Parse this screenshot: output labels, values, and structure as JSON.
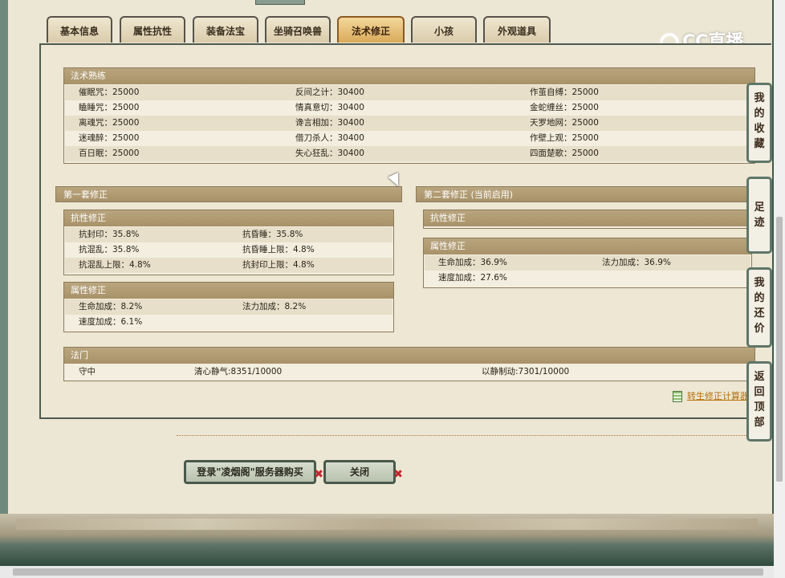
{
  "tabs": [
    "基本信息",
    "属性抗性",
    "装备法宝",
    "坐骑召唤兽",
    "法术修正",
    "小孩",
    "外观道具"
  ],
  "active_tab_index": 4,
  "logo_text": "CC直播",
  "spell_mastery": {
    "title": "法术熟练",
    "rows": [
      [
        "催眠咒：25000",
        "反间之计：30400",
        "作茧自缚：25000"
      ],
      [
        "瞌睡咒：25000",
        "情真意切：30400",
        "金蛇缠丝：25000"
      ],
      [
        "离魂咒：25000",
        "谗言相加：30400",
        "天罗地网：25000"
      ],
      [
        "迷魂醉：25000",
        "借刀杀人：30400",
        "作壁上观：25000"
      ],
      [
        "百日眠：25000",
        "失心狂乱：30400",
        "四面楚歌：25000"
      ]
    ]
  },
  "set1": {
    "title": "第一套修正",
    "resist": {
      "title": "抗性修正",
      "rows": [
        [
          "抗封印：35.8%",
          "抗昏睡：35.8%"
        ],
        [
          "抗混乱：35.8%",
          "抗昏睡上限：4.8%"
        ],
        [
          "抗混乱上限：4.8%",
          "抗封印上限：4.8%"
        ]
      ]
    },
    "attr": {
      "title": "属性修正",
      "rows": [
        [
          "生命加成：8.2%",
          "法力加成：8.2%"
        ],
        [
          "速度加成：6.1%",
          ""
        ]
      ]
    }
  },
  "set2": {
    "title": "第二套修正 (当前启用)",
    "resist": {
      "title": "抗性修正"
    },
    "attr": {
      "title": "属性修正",
      "rows": [
        [
          "生命加成：36.9%",
          "法力加成：36.9%"
        ],
        [
          "速度加成：27.6%",
          ""
        ]
      ]
    }
  },
  "famen": {
    "title": "法门",
    "items": [
      "守中",
      "清心静气:8351/10000",
      "以静制动:7301/10000"
    ]
  },
  "calc_link": "转生修正计算器",
  "side_buttons": [
    [
      "我",
      "的",
      "收",
      "藏"
    ],
    [
      "足",
      "迹"
    ],
    [
      "我",
      "的",
      "还",
      "价"
    ],
    [
      "返",
      "回",
      "顶",
      "部"
    ]
  ],
  "buttons": {
    "buy": "登录\"凌烟阁\"服务器购买",
    "close": "关闭",
    "x_mark": "✖"
  }
}
